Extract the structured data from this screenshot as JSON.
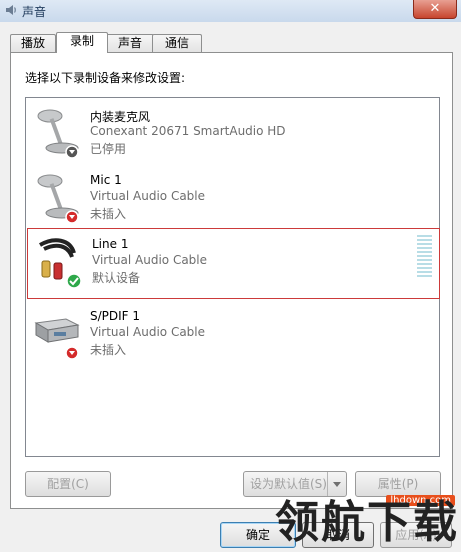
{
  "window": {
    "title": "声音",
    "close_label": "✕"
  },
  "tabs": [
    {
      "label": "播放"
    },
    {
      "label": "录制",
      "active": true
    },
    {
      "label": "声音"
    },
    {
      "label": "通信"
    }
  ],
  "prompt": "选择以下录制设备来修改设置:",
  "devices": [
    {
      "name": "内装麦克风",
      "desc": "Conexant 20671 SmartAudio HD",
      "status": "已停用",
      "icon": "microphone-icon",
      "badge": "disabled-down-arrow-badge"
    },
    {
      "name": "Mic 1",
      "desc": "Virtual Audio Cable",
      "status": "未插入",
      "icon": "microphone-icon",
      "badge": "unplugged-red-arrow-badge"
    },
    {
      "name": "Line 1",
      "desc": "Virtual Audio Cable",
      "status": "默认设备",
      "icon": "rca-cable-icon",
      "badge": "default-green-check-badge",
      "selected": true
    },
    {
      "name": "S/PDIF 1",
      "desc": "Virtual Audio Cable",
      "status": "未插入",
      "icon": "spdif-device-icon",
      "badge": "unplugged-red-arrow-badge"
    }
  ],
  "buttons": {
    "configure": "配置(C)",
    "set_default": "设为默认值(S)",
    "properties": "属性(P)",
    "ok": "确定",
    "cancel": "取消",
    "apply": "应用(A)"
  },
  "watermark": {
    "text": "领航下载",
    "url": "lhdown.com"
  },
  "colors": {
    "selection_border": "#cc3a3a",
    "level_meter": "#b8dde6",
    "status_gray": "#6d6d6d"
  }
}
